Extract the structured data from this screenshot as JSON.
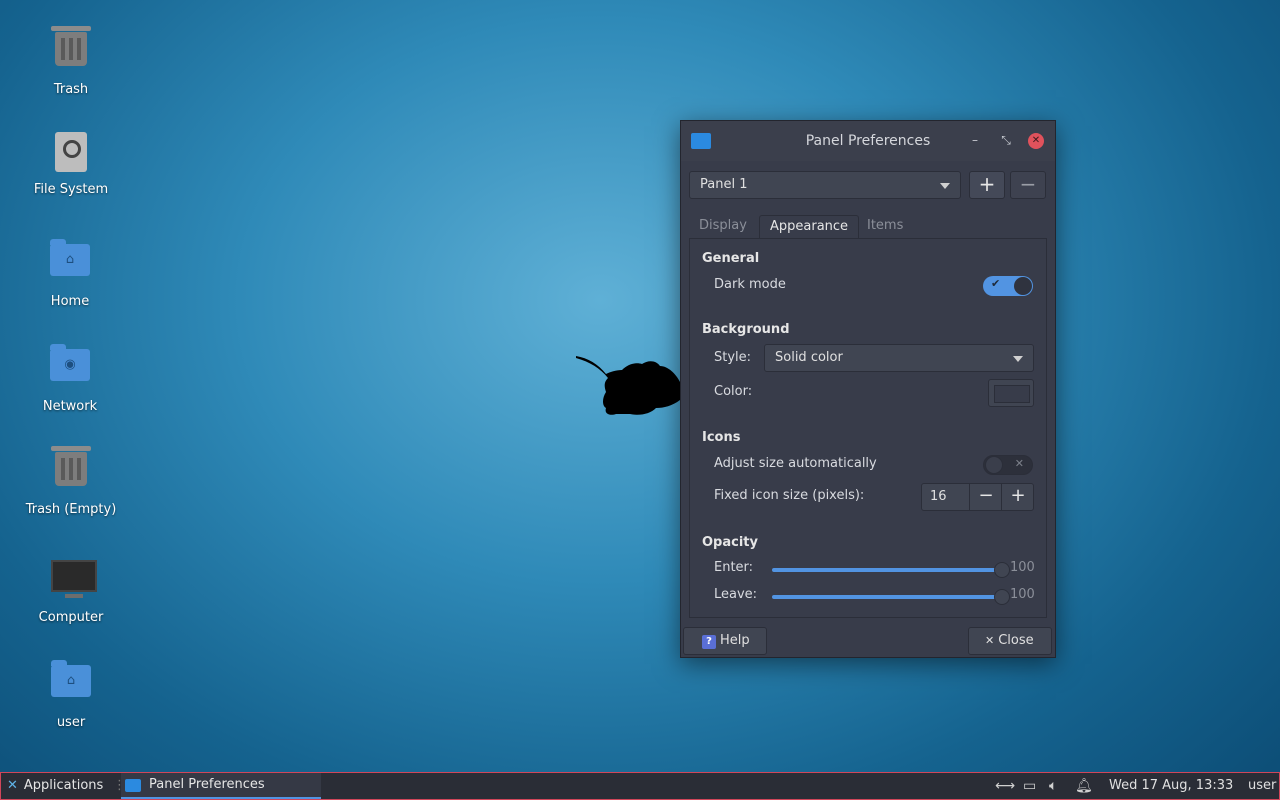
{
  "desktop": {
    "icons": [
      {
        "label": "Trash",
        "icon": "trash-icon"
      },
      {
        "label": "File System",
        "icon": "drive-icon"
      },
      {
        "label": "Home",
        "icon": "home-folder-icon"
      },
      {
        "label": "Network",
        "icon": "network-folder-icon"
      },
      {
        "label": "Trash (Empty)",
        "icon": "trash-icon"
      },
      {
        "label": "Computer",
        "icon": "computer-icon"
      },
      {
        "label": "user",
        "icon": "home-folder-icon"
      }
    ]
  },
  "dialog": {
    "title": "Panel Preferences",
    "minimize_glyph": "–",
    "restore_glyph": "⤡",
    "close_glyph": "✕",
    "panel_select": "Panel 1",
    "add_glyph": "+",
    "remove_glyph": "−",
    "tabs": [
      "Display",
      "Appearance",
      "Items"
    ],
    "active_tab": "Appearance",
    "general": {
      "title": "General",
      "dark_mode_label": "Dark mode",
      "dark_mode_on": true,
      "check_glyph": "✔"
    },
    "background": {
      "title": "Background",
      "style_label": "Style:",
      "style_value": "Solid color",
      "color_label": "Color:"
    },
    "icons": {
      "title": "Icons",
      "adjust_label": "Adjust size automatically",
      "adjust_on": false,
      "off_glyph": "✕",
      "fixed_label": "Fixed icon size (pixels):",
      "fixed_value": "16",
      "minus_glyph": "−",
      "plus_glyph": "+"
    },
    "opacity": {
      "title": "Opacity",
      "enter_label": "Enter:",
      "enter_value": "100",
      "leave_label": "Leave:",
      "leave_value": "100"
    },
    "help_label": "Help",
    "help_glyph": "?",
    "close_label": "Close",
    "close_btn_glyph": "✕"
  },
  "taskbar": {
    "apps_label": "Applications",
    "window_label": "Panel Preferences",
    "clock": "Wed 17 Aug, 13:33",
    "user": "user",
    "tray_icons": [
      "network-icon",
      "display-icon",
      "volume-icon",
      "notification-bell-icon"
    ]
  },
  "colors": {
    "accent": "#5294e2",
    "dialog_bg": "#383c4a",
    "taskbar_bg": "#2a2d36",
    "close_red": "#e0525c"
  }
}
